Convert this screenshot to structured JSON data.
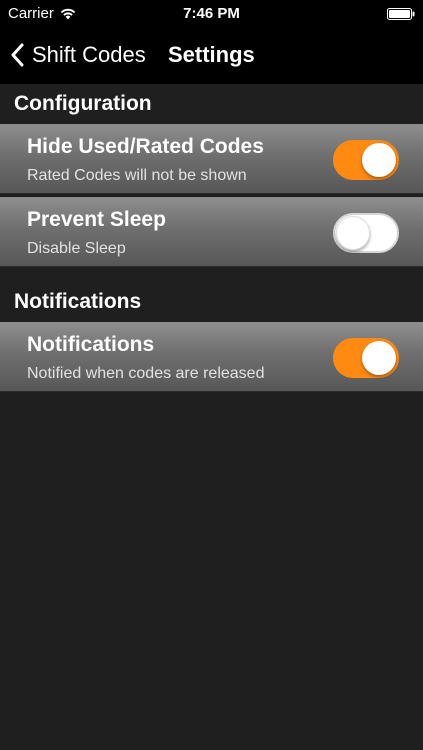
{
  "status_bar": {
    "carrier": "Carrier",
    "time": "7:46 PM"
  },
  "nav": {
    "back_label": "Shift Codes",
    "title": "Settings"
  },
  "sections": [
    {
      "header": "Configuration",
      "rows": [
        {
          "title": "Hide Used/Rated Codes",
          "subtitle": "Rated Codes will not be shown",
          "toggle_on": true
        },
        {
          "title": "Prevent Sleep",
          "subtitle": "Disable Sleep",
          "toggle_on": false
        }
      ]
    },
    {
      "header": "Notifications",
      "rows": [
        {
          "title": "Notifications",
          "subtitle": "Notified when codes are released",
          "toggle_on": true
        }
      ]
    }
  ],
  "colors": {
    "accent": "#ff8a12",
    "background": "#1f1f1f",
    "bar": "#000000"
  }
}
